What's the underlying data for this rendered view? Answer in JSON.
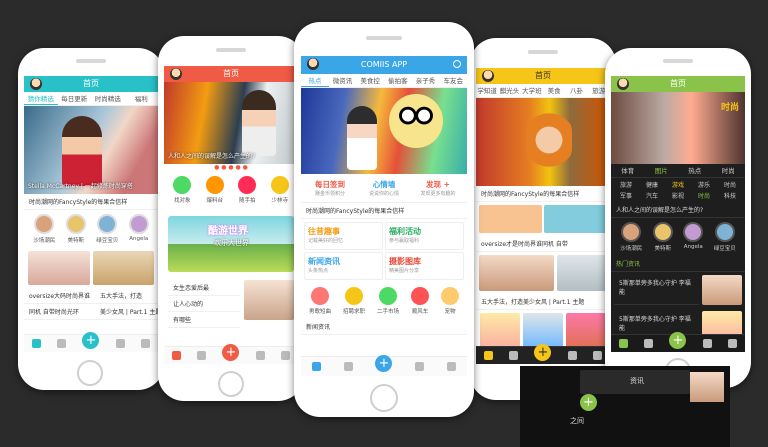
{
  "colors": {
    "bg": "#2b2b2b",
    "teal": "#28c1c8",
    "red": "#ef5b45",
    "blue": "#3aa6e8",
    "yellow": "#f5c518",
    "green": "#8bc34a"
  },
  "phone1": {
    "title": "首页",
    "tabs": [
      "猜你精选",
      "每日更新",
      "时尚精选",
      "福利"
    ],
    "banner_caption": "Stella McCartney | 一起修炼时尚穿搭",
    "headline": "时尚潮网的FancyStyle的每果合信样",
    "avatars": [
      "沙场潮民",
      "美特斯",
      "绿豆宝贝",
      "Angela"
    ],
    "post1": "oversize大码时尚界谁",
    "post1b": "同机 自带时尚光环",
    "post2": "五大手法，打造",
    "post2b": "美少女风 | Part.1 主题"
  },
  "phone2": {
    "title": "首页",
    "banner_caption": "人和人之间的误解是怎么产生的?",
    "icons": [
      "找对象",
      "爆料台",
      "随手拍",
      "少林寺"
    ],
    "ad_title": "酷游世界",
    "ad_sub": "欢乐大世界",
    "post1": "女生恋爱后最",
    "post1b": "让人心动的",
    "post1c": "有哪些"
  },
  "phone3": {
    "title": "COMIIS APP",
    "tabs": [
      "热点",
      "微资讯",
      "美食控",
      "偷拍客",
      "亲子秀",
      "车友会"
    ],
    "quick": [
      {
        "t": "每日签到",
        "s": "赚金币领积分"
      },
      {
        "t": "心情墙",
        "s": "说说你的心情"
      },
      {
        "t": "发现 +",
        "s": "发现更多有趣的"
      }
    ],
    "headline": "时尚潮网的FancyStyle的每果合信样",
    "grid": [
      {
        "t": "往昔趣事",
        "s": "记载美好的回忆"
      },
      {
        "t": "福利活动",
        "s": "参与赢取福利"
      },
      {
        "t": "新闻资讯",
        "s": "头条热点"
      },
      {
        "t": "摄影图库",
        "s": "精美图片分享"
      }
    ],
    "icons": [
      "男歌短曲",
      "招聘求职",
      "二手市场",
      "顺风车",
      "宠物"
    ],
    "news_label": "新闻资讯"
  },
  "phone4": {
    "title": "首页",
    "tabs": [
      "学知道",
      "麒光头",
      "大学班",
      "美食",
      "八卦",
      "旅游"
    ],
    "headline": "时尚潮网的FancyStyle的每果合信样",
    "post1": "oversize才是时尚界谁同机 自带",
    "post2": "五大手法，打造美少女风 | Part.1 主题"
  },
  "phone5": {
    "title": "首页",
    "tabs": [
      "体育",
      "图片",
      "热点",
      "时尚"
    ],
    "cats": [
      "旅游",
      "健康",
      "游戏",
      "游乐",
      "时尚",
      "军事",
      "汽车",
      "影视",
      "时尚",
      "科技"
    ],
    "headline": "人和人之间的误解是怎么产生的?",
    "avatars": [
      "沙场潮民",
      "美特斯",
      "Angela",
      "绿豆宝贝"
    ],
    "section": "热门资讯",
    "post1": "5斯那单旁多我心守护 李福能",
    "post2": "5斯那单旁多我心守护 李福能"
  },
  "overlay": {
    "label": "资讯",
    "sub": "之间"
  }
}
